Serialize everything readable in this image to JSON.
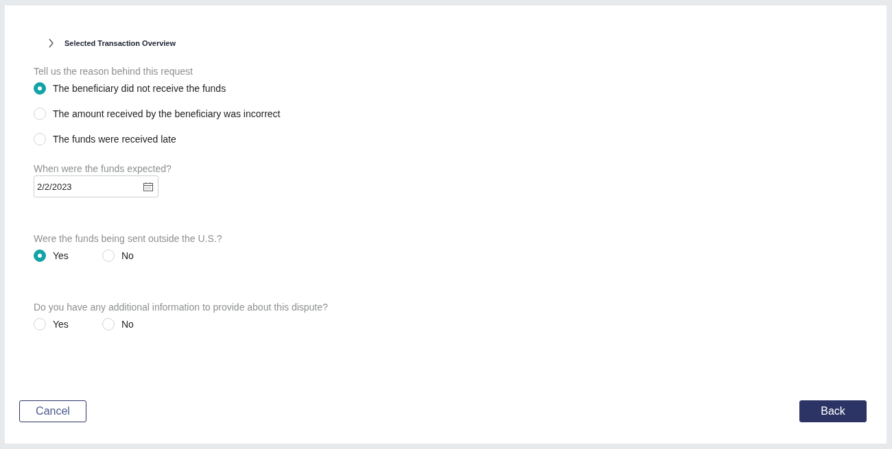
{
  "overview": {
    "title": "Selected Transaction Overview",
    "expanded": false
  },
  "questions": [
    {
      "kind": "radiolist",
      "label": "Tell us the reason behind this request",
      "options": [
        {
          "label": "The beneficiary did not receive the funds",
          "selected": true
        },
        {
          "label": "The amount received by the beneficiary was incorrect",
          "selected": false
        },
        {
          "label": "The funds were received late",
          "selected": false
        }
      ]
    },
    {
      "kind": "date",
      "label": "When were the funds expected?",
      "value": "2/2/2023"
    },
    {
      "kind": "radiorow",
      "label": "Were the funds being sent outside the U.S.?",
      "options": [
        {
          "label": "Yes",
          "selected": true
        },
        {
          "label": "No",
          "selected": false
        }
      ]
    },
    {
      "kind": "radiorow",
      "label": "Do you have any additional information to provide about this dispute?",
      "options": [
        {
          "label": "Yes",
          "selected": false
        },
        {
          "label": "No",
          "selected": false
        }
      ]
    }
  ],
  "buttons": [
    {
      "label": "Cancel",
      "kind": "secondary"
    },
    {
      "label": "Back",
      "kind": "primary"
    }
  ]
}
